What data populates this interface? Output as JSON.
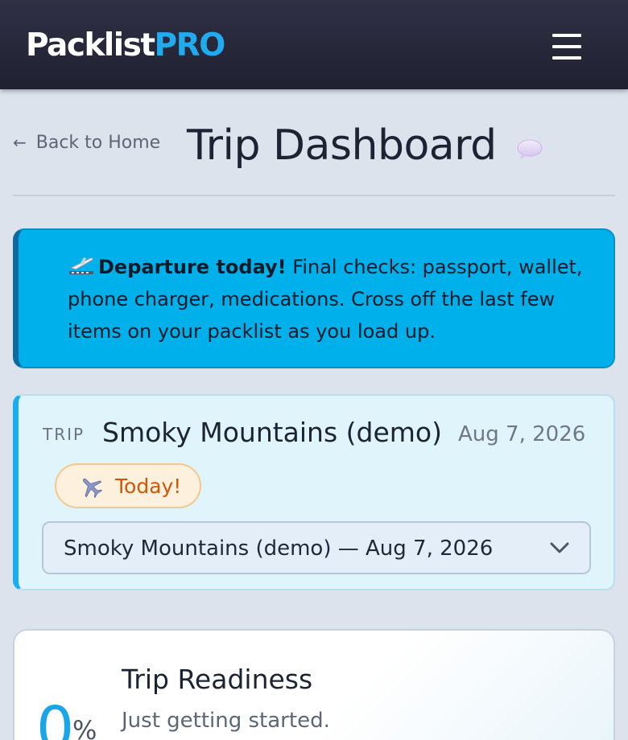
{
  "header": {
    "brand_main": "Packlist",
    "brand_accent": "PRO",
    "menu_icon": "hamburger-menu-icon"
  },
  "title_row": {
    "back_arrow": "←",
    "back_label": "Back to Home",
    "page_title": "Trip Dashboard",
    "chat_icon": "speech-bubble-icon"
  },
  "alert": {
    "icon": "airplane-departure-icon",
    "heading": "Departure today!",
    "message": " Final checks: passport, wallet, phone charger, medications. Cross off the last few items on your packlist as you load up."
  },
  "trip": {
    "label": "TRIP",
    "name": "Smoky Mountains (demo)",
    "date": "Aug 7, 2026",
    "badge_icon": "airplane-icon",
    "badge_label": "Today!",
    "selected_option": "Smoky Mountains (demo) — Aug 7, 2026"
  },
  "readiness": {
    "title": "Trip Readiness",
    "percent": "0",
    "unit": "%",
    "subtitle": "Just getting started."
  },
  "colors": {
    "header_bg": "#2f3044",
    "brand_accent": "#22aaee",
    "alert_bg": "#00b0ea",
    "card_accent": "#19aef0",
    "badge_text": "#d0570a",
    "percent": "#19a6e8"
  }
}
